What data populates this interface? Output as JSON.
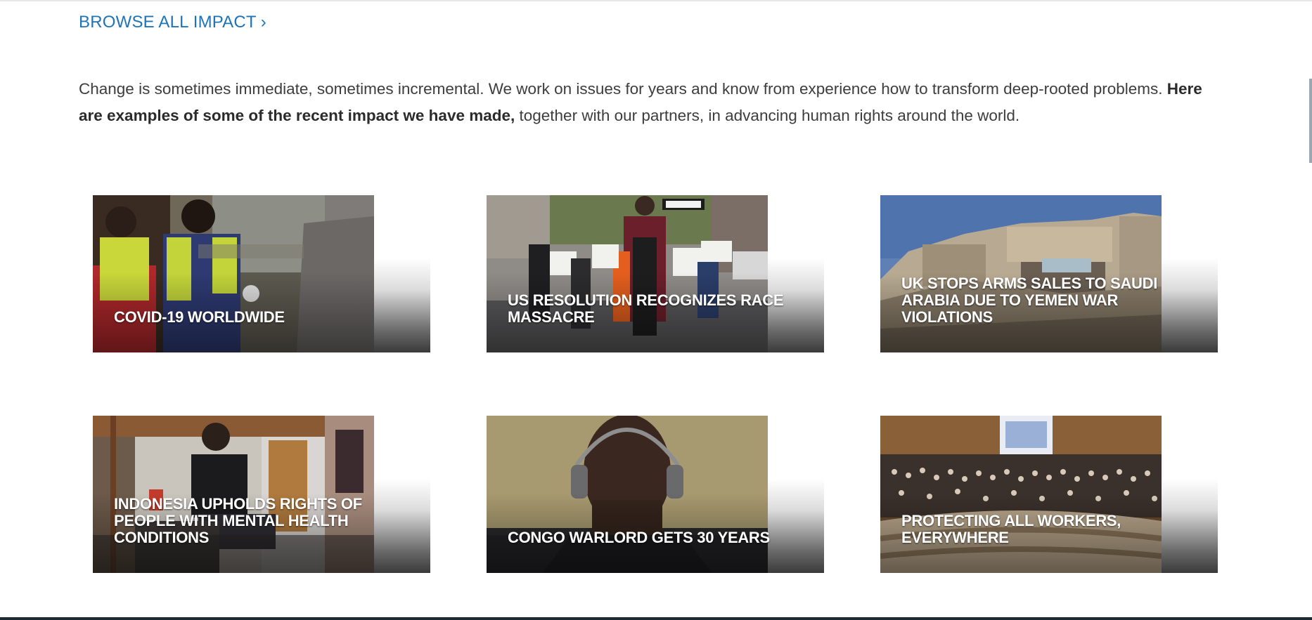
{
  "header": {
    "browse_label": "BROWSE ALL IMPACT",
    "browse_chevron": "›"
  },
  "intro": {
    "part1": "Change is sometimes immediate, sometimes incremental. We work on issues for years and know from experience how to transform deep-rooted problems. ",
    "bold": "Here are examples of some of the recent impact we have made,",
    "part2": " together with our partners, in advancing human rights around the world."
  },
  "cards": [
    {
      "title": "COVID-19 WORLDWIDE",
      "image": "health-workers-photo"
    },
    {
      "title": "US RESOLUTION RECOGNIZES RACE MASSACRE",
      "image": "march-remember-1921-photo"
    },
    {
      "title": "UK STOPS ARMS SALES TO SAUDI ARABIA DUE TO YEMEN WAR VIOLATIONS",
      "image": "destroyed-building-photo"
    },
    {
      "title": "INDONESIA UPHOLDS RIGHTS OF PEOPLE WITH MENTAL HEALTH CONDITIONS",
      "image": "workshop-man-photo"
    },
    {
      "title": "CONGO WARLORD GETS 30 YEARS",
      "image": "man-headphones-photo"
    },
    {
      "title": "PROTECTING ALL WORKERS, EVERYWHERE",
      "image": "assembly-hall-photo"
    }
  ],
  "colors": {
    "link": "#1f74b8",
    "text": "#3d3d3d"
  }
}
